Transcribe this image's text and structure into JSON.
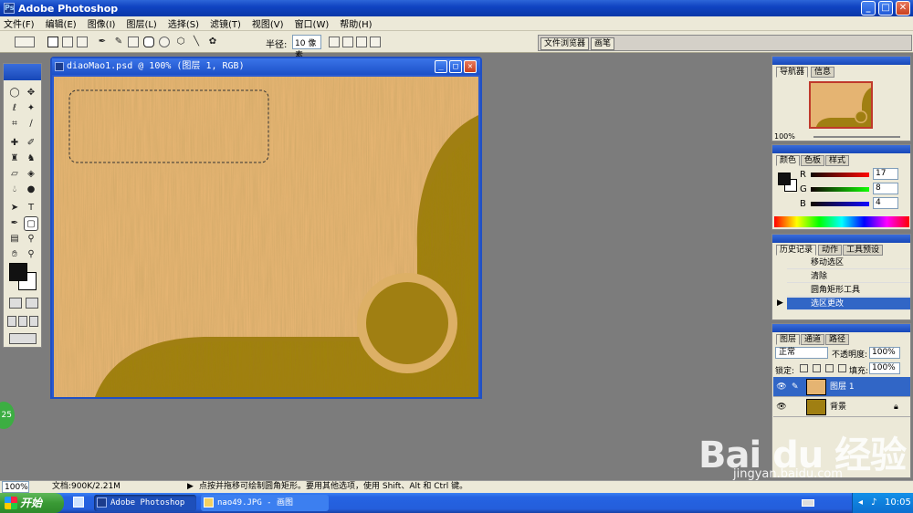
{
  "app": {
    "title": "Adobe Photoshop",
    "icon": "ps-icon"
  },
  "window_buttons": {
    "minimize": "_",
    "maximize": "□",
    "close": "✕"
  },
  "menu": [
    "文件(F)",
    "编辑(E)",
    "图像(I)",
    "图层(L)",
    "选择(S)",
    "滤镜(T)",
    "视图(V)",
    "窗口(W)",
    "帮助(H)"
  ],
  "options": {
    "radius_label": "半径:",
    "radius_value": "10 像素",
    "palette_tabs": [
      "文件浏览器",
      "画笔"
    ]
  },
  "document": {
    "title": "diaoMao1.psd @ 100% (图层 1, RGB)",
    "colors": {
      "wood_light": "#e5b472",
      "wood_dark": "#a07f12",
      "ring": "#ddb066"
    }
  },
  "toolbox": {
    "tools": [
      "marquee-ellipse-icon",
      "move-icon",
      "lasso-icon",
      "magic-wand-icon",
      "crop-icon",
      "slice-icon",
      "healing-brush-icon",
      "brush-icon",
      "clone-stamp-icon",
      "history-brush-icon",
      "eraser-icon",
      "paint-bucket-icon",
      "blur-icon",
      "dodge-icon",
      "path-select-icon",
      "type-icon",
      "pen-icon",
      "rounded-rect-icon",
      "notes-icon",
      "eyedropper-icon",
      "hand-icon",
      "zoom-icon"
    ],
    "fg_color": "#111111",
    "bg_color": "#ffffff"
  },
  "navigator": {
    "tabs": [
      "导航器",
      "信息"
    ],
    "zoom": "100%"
  },
  "color_panel": {
    "tabs": [
      "颜色",
      "色板",
      "样式"
    ],
    "channels": [
      {
        "label": "R",
        "value": "17"
      },
      {
        "label": "G",
        "value": "8"
      },
      {
        "label": "B",
        "value": "4"
      }
    ]
  },
  "history": {
    "tabs": [
      "历史记录",
      "动作",
      "工具预设"
    ],
    "items": [
      "移动选区",
      "清除",
      "圆角矩形工具",
      "选区更改"
    ],
    "selected_index": 3
  },
  "layers": {
    "tabs": [
      "图层",
      "通道",
      "路径"
    ],
    "blend_mode": "正常",
    "opacity_label": "不透明度:",
    "opacity": "100%",
    "lock_label": "锁定:",
    "fill_label": "填充:",
    "fill": "100%",
    "items": [
      {
        "name": "图层 1",
        "selected": true
      },
      {
        "name": "背景",
        "selected": false
      }
    ]
  },
  "status": {
    "zoom": "100%",
    "doc_info": "文档:900K/2.21M",
    "hint": "点按并拖移可绘制圆角矩形。要用其他选项，使用 Shift、Alt 和 Ctrl 键。"
  },
  "taskbar": {
    "start": "开始",
    "tasks": [
      "Adobe Photoshop",
      "nao49.JPG - 画图"
    ],
    "clock": "10:05"
  },
  "side_badge": "25",
  "watermark": {
    "logo": "Bai du 经验",
    "url": "jingyan.baidu.com"
  }
}
